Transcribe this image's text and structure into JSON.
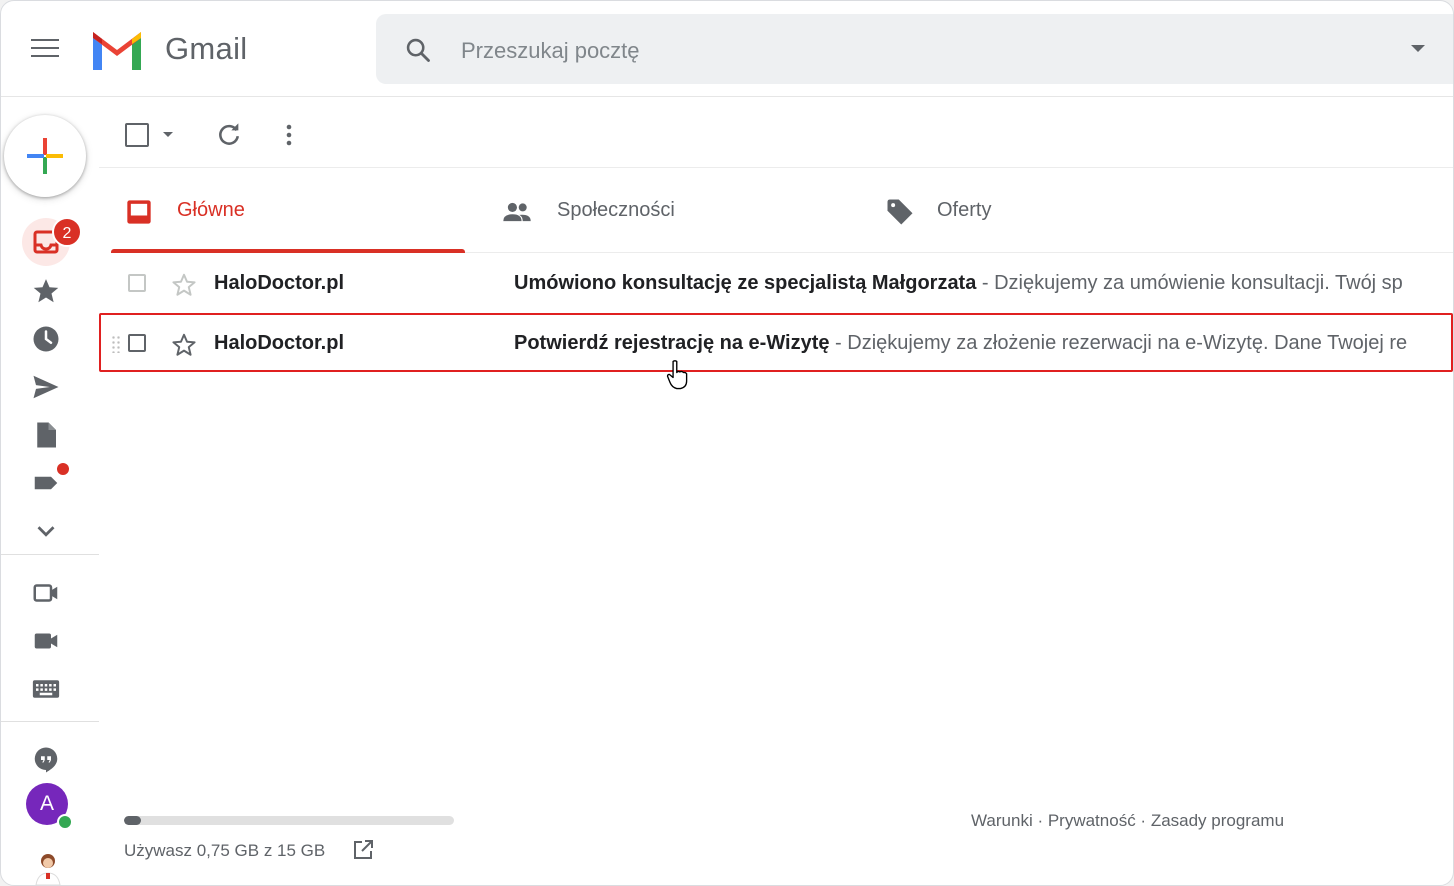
{
  "app": {
    "name": "Gmail"
  },
  "search": {
    "placeholder": "Przeszukaj pocztę"
  },
  "nav": {
    "inbox_badge": "2",
    "avatar_letter": "A"
  },
  "tabs": [
    {
      "label": "Główne",
      "active": true
    },
    {
      "label": "Społeczności",
      "active": false
    },
    {
      "label": "Oferty",
      "active": false
    }
  ],
  "emails": [
    {
      "sender": "HaloDoctor.pl",
      "subject": "Umówiono konsultację ze specjalistą Małgorzata",
      "snippet": " - Dziękujemy za umówienie konsultacji. Twój sp"
    },
    {
      "sender": "HaloDoctor.pl",
      "subject": "Potwierdź rejestrację na e-Wizytę",
      "snippet": " - Dziękujemy za złożenie rezerwacji na e-Wizytę. Dane Twojej re"
    }
  ],
  "storage": {
    "text": "Używasz 0,75 GB z 15 GB",
    "used_fraction": 0.05
  },
  "footer": {
    "terms": "Warunki",
    "privacy": "Prywatność",
    "policy": "Zasady programu",
    "sep": " · "
  },
  "colors": {
    "accent": "#d93025",
    "highlight_border": "#e02020"
  }
}
